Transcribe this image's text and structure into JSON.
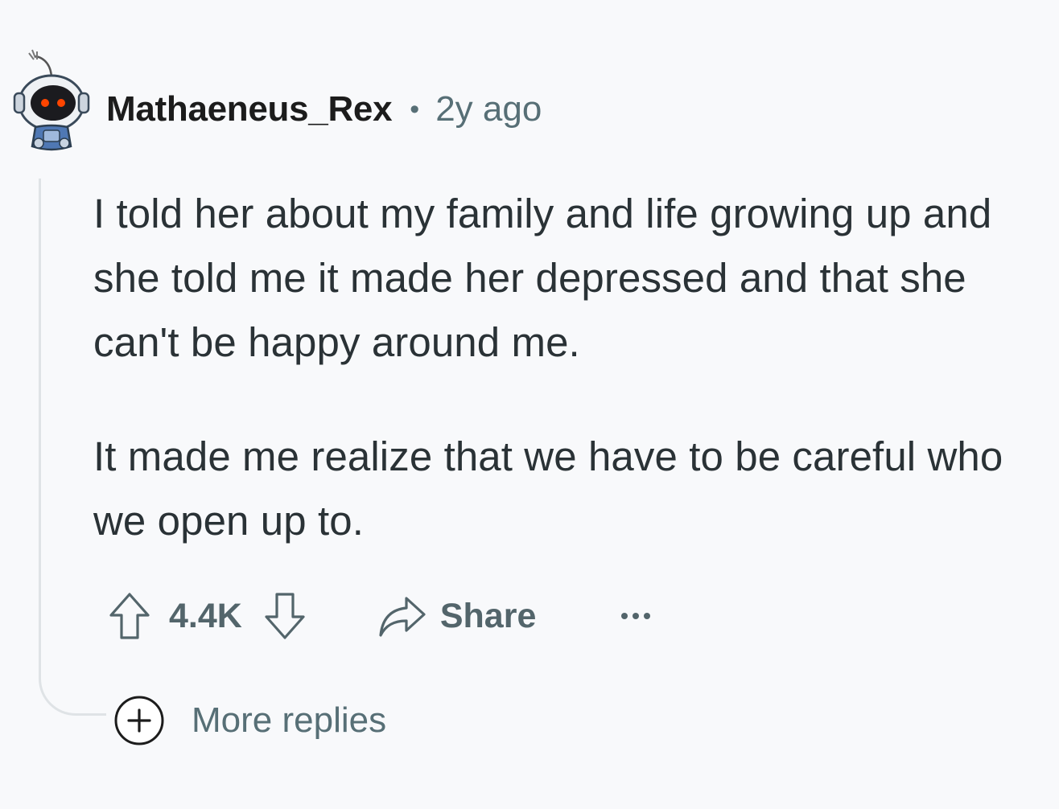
{
  "comment": {
    "author": "Mathaeneus_Rex",
    "separator": "•",
    "age": "2y ago",
    "avatar_icon": "snoo-robot-avatar-icon",
    "paragraphs": [
      "I told her about my family and life growing up and she told me it made her depressed and that she can't be happy around me.",
      "It made me realize that we have to be careful who we open up to."
    ],
    "actions": {
      "upvote_icon": "upvote-arrow-icon",
      "score": "4.4K",
      "downvote_icon": "downvote-arrow-icon",
      "share_icon": "share-arrow-icon",
      "share_label": "Share",
      "overflow_icon": "more-options-icon"
    },
    "more_replies": {
      "icon": "plus-circle-icon",
      "label": "More replies"
    }
  },
  "colors": {
    "background": "#f8f9fb",
    "text_primary": "#2a3236",
    "text_secondary": "#576f76",
    "thread_line": "#dfe3e6"
  }
}
